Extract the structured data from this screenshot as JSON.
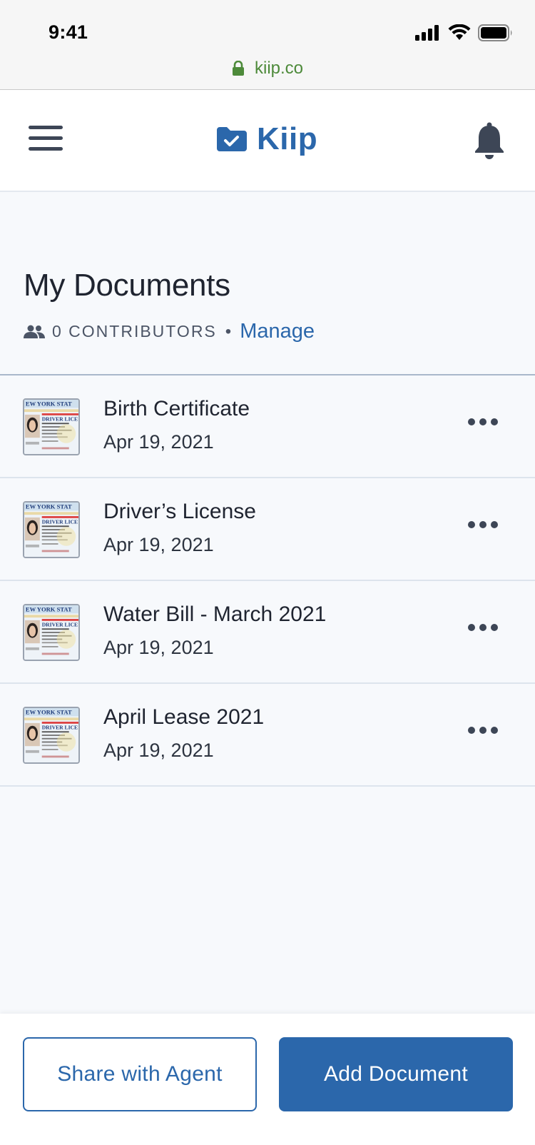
{
  "status": {
    "time": "9:41"
  },
  "browser": {
    "url": "kiip.co"
  },
  "header": {
    "logo_text": "Kiip"
  },
  "page": {
    "title": "My Documents",
    "contributors_text": "0 CONTRIBUTORS",
    "separator": "•",
    "manage_label": "Manage"
  },
  "documents": [
    {
      "name": "Birth Certificate",
      "date": "Apr 19, 2021",
      "thumbnail": "id-card-thumbnail"
    },
    {
      "name": "Driver’s License",
      "date": "Apr 19, 2021",
      "thumbnail": "id-card-thumbnail"
    },
    {
      "name": "Water Bill - March 2021",
      "date": "Apr 19, 2021",
      "thumbnail": "id-card-thumbnail"
    },
    {
      "name": "April Lease 2021",
      "date": "Apr 19, 2021",
      "thumbnail": "id-card-thumbnail"
    }
  ],
  "actions": {
    "share_label": "Share with Agent",
    "add_label": "Add Document"
  },
  "colors": {
    "brand": "#2b67ab",
    "url_green": "#4d8a3a",
    "background": "#f7f9fc",
    "icon_gray": "#3d4656"
  }
}
